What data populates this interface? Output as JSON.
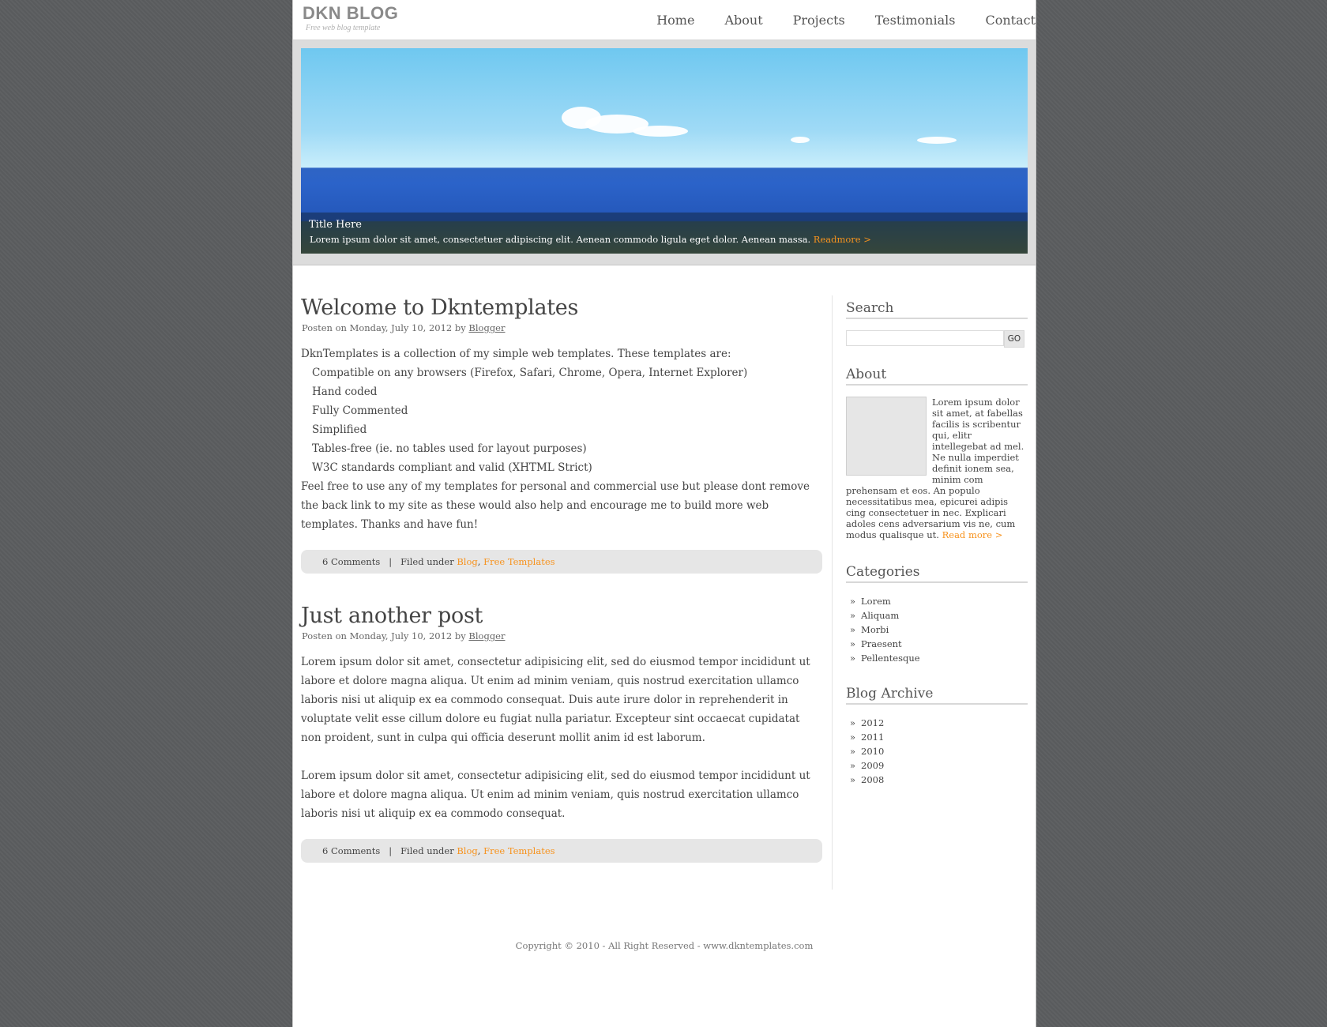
{
  "header": {
    "logo_title": "DKN BLOG",
    "logo_tagline": "Free web blog template",
    "nav": [
      "Home",
      "About",
      "Projects",
      "Testimonials",
      "Contact"
    ]
  },
  "banner": {
    "title": "Title Here",
    "text": "Lorem ipsum dolor sit amet, consectetuer adipiscing elit. Aenean commodo ligula eget dolor. Aenean massa.",
    "readmore": "Readmore >"
  },
  "posts": [
    {
      "title": "Welcome to Dkntemplates",
      "meta_prefix": "Posten on Monday, July 10,  2012 by",
      "author": "Blogger",
      "intro": "DknTemplates is a collection of my simple web templates. These templates are:",
      "list": [
        "Compatible on any browsers (Firefox, Safari, Chrome, Opera, Internet Explorer)",
        "Hand coded",
        "Fully Commented",
        "Simplified",
        "Tables-free (ie. no tables used for layout purposes)",
        "W3C standards compliant and valid (XHTML Strict)"
      ],
      "outro": "Feel free to use any of my templates for personal and commercial use but please dont remove the back link to my site as these would also help and encourage me to build more web templates. Thanks and have fun!",
      "comments": "6  Comments",
      "filed_under": "Filed under",
      "tag1": "Blog",
      "tag2": "Free Templates"
    },
    {
      "title": "Just another post",
      "meta_prefix": "Posten on Monday, July 10,  2012 by",
      "author": "Blogger",
      "para1": "Lorem ipsum dolor sit amet, consectetur adipisicing elit, sed do eiusmod tempor incididunt ut labore et dolore magna aliqua. Ut enim ad minim veniam, quis nostrud exercitation ullamco laboris nisi ut aliquip ex ea commodo consequat. Duis aute irure dolor in reprehenderit in voluptate velit esse cillum dolore eu fugiat nulla pariatur. Excepteur sint occaecat cupidatat non proident, sunt in culpa qui officia deserunt mollit anim id est laborum.",
      "para2": "Lorem ipsum dolor sit amet, consectetur adipisicing elit, sed do eiusmod tempor incididunt ut labore et dolore magna aliqua. Ut enim ad minim veniam, quis nostrud exercitation ullamco laboris nisi ut aliquip ex ea commodo consequat.",
      "comments": "6  Comments",
      "filed_under": "Filed under",
      "tag1": "Blog",
      "tag2": "Free Templates"
    }
  ],
  "sidebar": {
    "search_title": "Search",
    "search_button": "GO",
    "about_title": "About",
    "about_text": "Lorem ipsum dolor sit amet, at fabellas facilis is scribentur qui, elitr intellegebat ad mel. Ne nulla imperdiet definit ionem sea, minim com prehensam et eos. An populo necessitatibus mea, epicurei adipis cing consectetuer in nec. Explicari adoles cens adversarium vis ne, cum modus qualisque ut.",
    "about_readmore": "Read more >",
    "categories_title": "Categories",
    "categories": [
      "Lorem",
      "Aliquam",
      "Morbi",
      "Praesent",
      "Pellentesque"
    ],
    "archive_title": "Blog Archive",
    "archive": [
      "2012",
      "2011",
      "2010",
      "2009",
      "2008"
    ]
  },
  "footer": {
    "text": "Copyright © 2010 - All Right Reserved - www.dkntemplates.com"
  },
  "colors": {
    "accent": "#f7931e",
    "background": "#5b5d5f",
    "post_footer_bg": "#e6e6e6"
  }
}
